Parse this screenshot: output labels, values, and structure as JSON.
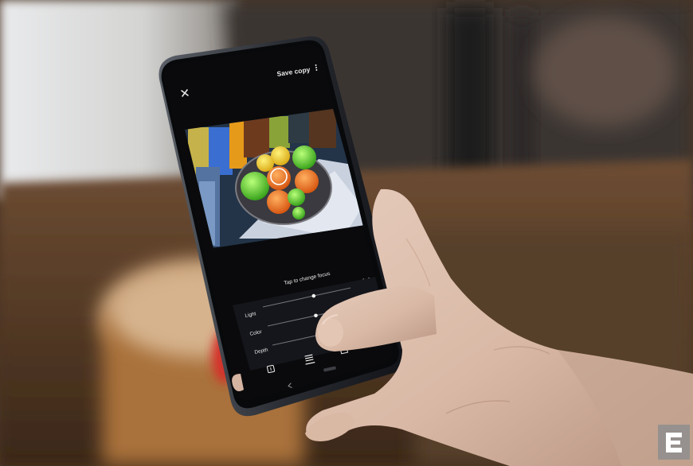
{
  "photo": {
    "subject": "Hand holding a smartphone showing a photo editor"
  },
  "editor": {
    "save_label": "Save copy",
    "focus_hint": "Tap to change focus",
    "sliders": [
      {
        "label": "Light",
        "value": 0.58
      },
      {
        "label": "Color",
        "value": 0.55
      },
      {
        "label": "Depth",
        "value": 0.72
      }
    ]
  },
  "colors": {
    "screen_bg": "#0a0a0c",
    "accent_green": "#4bc22a",
    "accent_orange": "#ef6a17",
    "skin": "#dcbfae"
  }
}
